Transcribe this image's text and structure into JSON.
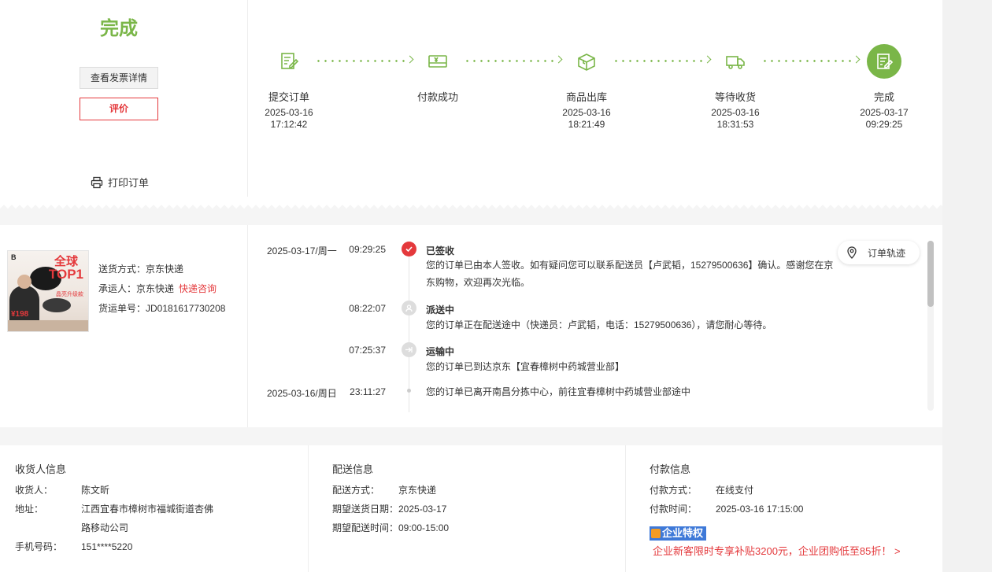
{
  "status": {
    "title": "完成"
  },
  "actions": {
    "invoice_label": "查看发票详情",
    "review_label": "评价",
    "print_label": "打印订单"
  },
  "progress": {
    "steps": [
      {
        "label": "提交订单",
        "date": "2025-03-16",
        "time": "17:12:42",
        "icon": "edit-doc-icon"
      },
      {
        "label": "付款成功",
        "date": "",
        "time": "",
        "icon": "payment-card-icon"
      },
      {
        "label": "商品出库",
        "date": "2025-03-16",
        "time": "18:21:49",
        "icon": "package-icon"
      },
      {
        "label": "等待收货",
        "date": "2025-03-16",
        "time": "18:31:53",
        "icon": "delivery-truck-icon"
      },
      {
        "label": "完成",
        "date": "2025-03-17",
        "time": "09:29:25",
        "icon": "edit-doc-icon"
      }
    ]
  },
  "shipping": {
    "method_label": "送货方式：",
    "method": "京东快递",
    "carrier_label": "承运人：",
    "carrier": "京东快递",
    "consult_link": "快递咨询",
    "tracking_label": "货运单号：",
    "tracking_no": "JD0181617730208"
  },
  "product_image": {
    "logo": "B",
    "top_line1": "全球",
    "top_line2": "TOP1",
    "badge": "晶亮升级款",
    "price": "¥198"
  },
  "timeline": {
    "track_label": "订单轨迹",
    "events": [
      {
        "date": "2025-03-17/周一",
        "time": "09:29:25",
        "title": "已签收",
        "text": "您的订单已由本人签收。如有疑问您可以联系配送员【卢武韬，15279500636】确认。感谢您在京东购物，欢迎再次光临。"
      },
      {
        "date": "",
        "time": "08:22:07",
        "title": "派送中",
        "text": "您的订单正在配送途中（快递员：卢武韬，电话：15279500636），请您耐心等待。"
      },
      {
        "date": "",
        "time": "07:25:37",
        "title": "运输中",
        "text": "您的订单已到达京东【宜春樟树中药城营业部】"
      },
      {
        "date": "2025-03-16/周日",
        "time": "23:11:27",
        "title": "",
        "text": "您的订单已离开南昌分拣中心，前往宜春樟树中药城营业部途中"
      }
    ]
  },
  "receiver": {
    "title": "收货人信息",
    "name_label": "收货人：",
    "name": "陈文昕",
    "address_label": "地址：",
    "address_line1": "江西宜春市樟树市福城街道杏佛",
    "address_line2": "路移动公司",
    "phone_label": "手机号码：",
    "phone": "151****5220"
  },
  "delivery": {
    "title": "配送信息",
    "method_label": "配送方式：",
    "method": "京东快递",
    "date_label": "期望送货日期：",
    "date": "2025-03-17",
    "time_label": "期望配送时间：",
    "time": "09:00-15:00"
  },
  "payment": {
    "title": "付款信息",
    "method_label": "付款方式：",
    "method": "在线支付",
    "time_label": "付款时间：",
    "time": "2025-03-16 17:15:00",
    "badge": "企业特权",
    "promo": "企业新客限时专享补贴3200元，企业团购低至85折！ >"
  },
  "colors": {
    "accent_green": "#7ab648",
    "accent_red": "#e4393c",
    "badge_blue": "#3e79d8"
  }
}
